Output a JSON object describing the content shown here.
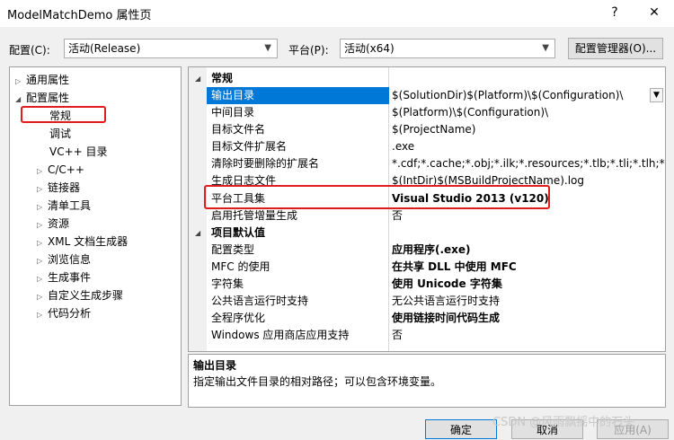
{
  "window": {
    "title": "ModelMatchDemo 属性页",
    "help_glyph": "?",
    "close_glyph": "✕"
  },
  "toolbar": {
    "config_label": "配置(C):",
    "config_value": "活动(Release)",
    "platform_label": "平台(P):",
    "platform_value": "活动(x64)",
    "config_manager_label": "配置管理器(O)..."
  },
  "tree": {
    "items": [
      {
        "label": "通用属性",
        "expander": "▷"
      },
      {
        "label": "配置属性",
        "expander": "◢"
      },
      {
        "label": "常规"
      },
      {
        "label": "调试"
      },
      {
        "label": "VC++ 目录"
      },
      {
        "label": "C/C++",
        "expander": "▷"
      },
      {
        "label": "链接器",
        "expander": "▷"
      },
      {
        "label": "清单工具",
        "expander": "▷"
      },
      {
        "label": "资源",
        "expander": "▷"
      },
      {
        "label": "XML 文档生成器",
        "expander": "▷"
      },
      {
        "label": "浏览信息",
        "expander": "▷"
      },
      {
        "label": "生成事件",
        "expander": "▷"
      },
      {
        "label": "自定义生成步骤",
        "expander": "▷"
      },
      {
        "label": "代码分析",
        "expander": "▷"
      }
    ]
  },
  "grid": {
    "sections": [
      {
        "name": "常规",
        "expander": "◢",
        "rows": [
          {
            "key": "输出目录",
            "value": "$(SolutionDir)$(Platform)\\$(Configuration)\\"
          },
          {
            "key": "中间目录",
            "value": "$(Platform)\\$(Configuration)\\"
          },
          {
            "key": "目标文件名",
            "value": "$(ProjectName)"
          },
          {
            "key": "目标文件扩展名",
            "value": ".exe"
          },
          {
            "key": "清除时要删除的扩展名",
            "value": "*.cdf;*.cache;*.obj;*.ilk;*.resources;*.tlb;*.tli;*.tlh;*.tmp;*"
          },
          {
            "key": "生成日志文件",
            "value": "$(IntDir)$(MSBuildProjectName).log"
          },
          {
            "key": "平台工具集",
            "value": "Visual Studio 2013 (v120)"
          },
          {
            "key": "启用托管增量生成",
            "value": "否"
          }
        ]
      },
      {
        "name": "项目默认值",
        "expander": "◢",
        "rows": [
          {
            "key": "配置类型",
            "value": "应用程序(.exe)"
          },
          {
            "key": "MFC 的使用",
            "value": "在共享 DLL 中使用 MFC"
          },
          {
            "key": "字符集",
            "value": "使用 Unicode 字符集"
          },
          {
            "key": "公共语言运行时支持",
            "value": "无公共语言运行时支持"
          },
          {
            "key": "全程序优化",
            "value": "使用链接时间代码生成"
          },
          {
            "key": "Windows 应用商店应用支持",
            "value": "否"
          }
        ]
      }
    ]
  },
  "description": {
    "title": "输出目录",
    "text": "指定输出文件目录的相对路径；可以包含环境变量。"
  },
  "footer": {
    "ok_label": "确定",
    "cancel_label": "取消",
    "apply_label": "应用(A)"
  },
  "watermark": "CSDN @风雨飘摇中的石头",
  "colors": {
    "selection": "#0078d7",
    "highlight_box": "#e01c1c"
  }
}
